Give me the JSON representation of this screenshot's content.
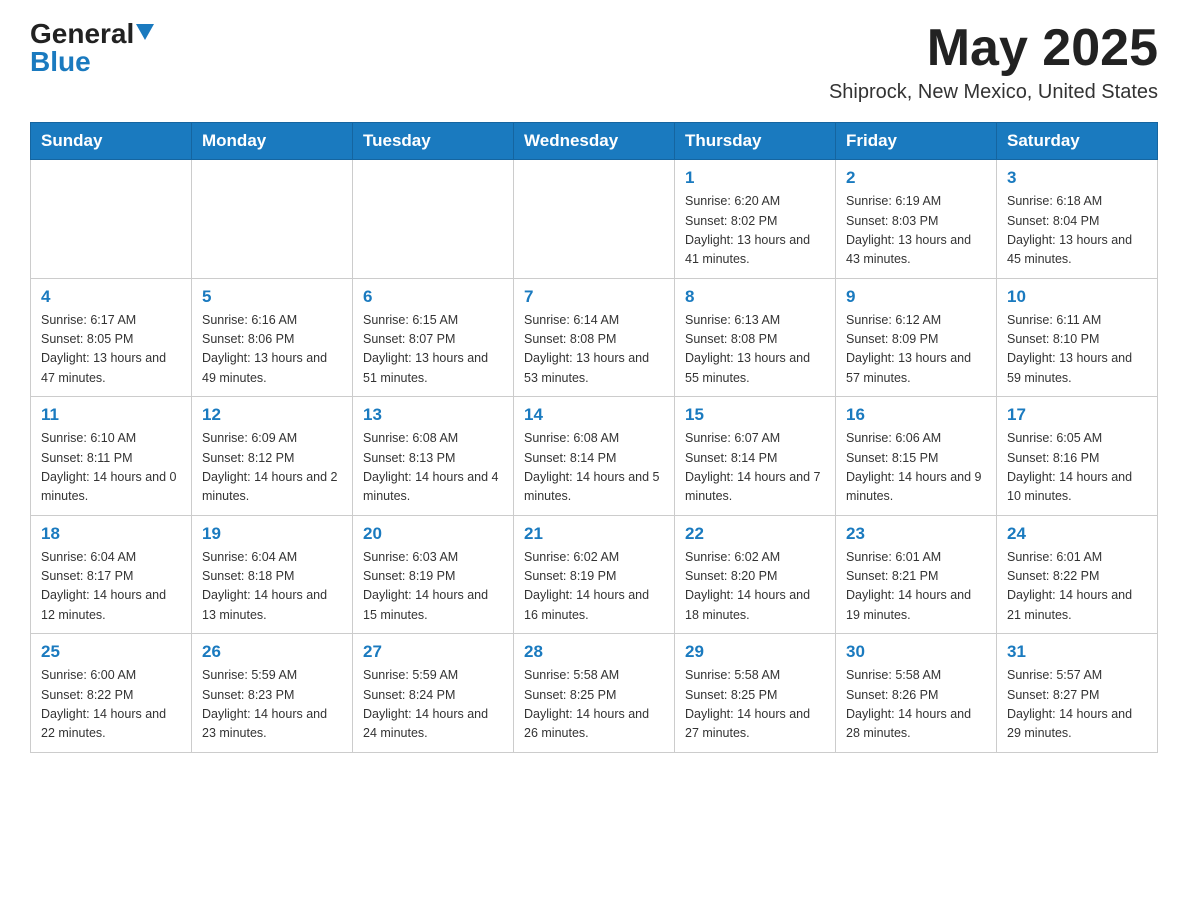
{
  "header": {
    "logo": {
      "general": "General",
      "blue": "Blue"
    },
    "title": "May 2025",
    "location": "Shiprock, New Mexico, United States"
  },
  "weekdays": [
    "Sunday",
    "Monday",
    "Tuesday",
    "Wednesday",
    "Thursday",
    "Friday",
    "Saturday"
  ],
  "weeks": [
    [
      {
        "day": "",
        "info": ""
      },
      {
        "day": "",
        "info": ""
      },
      {
        "day": "",
        "info": ""
      },
      {
        "day": "",
        "info": ""
      },
      {
        "day": "1",
        "info": "Sunrise: 6:20 AM\nSunset: 8:02 PM\nDaylight: 13 hours and 41 minutes."
      },
      {
        "day": "2",
        "info": "Sunrise: 6:19 AM\nSunset: 8:03 PM\nDaylight: 13 hours and 43 minutes."
      },
      {
        "day": "3",
        "info": "Sunrise: 6:18 AM\nSunset: 8:04 PM\nDaylight: 13 hours and 45 minutes."
      }
    ],
    [
      {
        "day": "4",
        "info": "Sunrise: 6:17 AM\nSunset: 8:05 PM\nDaylight: 13 hours and 47 minutes."
      },
      {
        "day": "5",
        "info": "Sunrise: 6:16 AM\nSunset: 8:06 PM\nDaylight: 13 hours and 49 minutes."
      },
      {
        "day": "6",
        "info": "Sunrise: 6:15 AM\nSunset: 8:07 PM\nDaylight: 13 hours and 51 minutes."
      },
      {
        "day": "7",
        "info": "Sunrise: 6:14 AM\nSunset: 8:08 PM\nDaylight: 13 hours and 53 minutes."
      },
      {
        "day": "8",
        "info": "Sunrise: 6:13 AM\nSunset: 8:08 PM\nDaylight: 13 hours and 55 minutes."
      },
      {
        "day": "9",
        "info": "Sunrise: 6:12 AM\nSunset: 8:09 PM\nDaylight: 13 hours and 57 minutes."
      },
      {
        "day": "10",
        "info": "Sunrise: 6:11 AM\nSunset: 8:10 PM\nDaylight: 13 hours and 59 minutes."
      }
    ],
    [
      {
        "day": "11",
        "info": "Sunrise: 6:10 AM\nSunset: 8:11 PM\nDaylight: 14 hours and 0 minutes."
      },
      {
        "day": "12",
        "info": "Sunrise: 6:09 AM\nSunset: 8:12 PM\nDaylight: 14 hours and 2 minutes."
      },
      {
        "day": "13",
        "info": "Sunrise: 6:08 AM\nSunset: 8:13 PM\nDaylight: 14 hours and 4 minutes."
      },
      {
        "day": "14",
        "info": "Sunrise: 6:08 AM\nSunset: 8:14 PM\nDaylight: 14 hours and 5 minutes."
      },
      {
        "day": "15",
        "info": "Sunrise: 6:07 AM\nSunset: 8:14 PM\nDaylight: 14 hours and 7 minutes."
      },
      {
        "day": "16",
        "info": "Sunrise: 6:06 AM\nSunset: 8:15 PM\nDaylight: 14 hours and 9 minutes."
      },
      {
        "day": "17",
        "info": "Sunrise: 6:05 AM\nSunset: 8:16 PM\nDaylight: 14 hours and 10 minutes."
      }
    ],
    [
      {
        "day": "18",
        "info": "Sunrise: 6:04 AM\nSunset: 8:17 PM\nDaylight: 14 hours and 12 minutes."
      },
      {
        "day": "19",
        "info": "Sunrise: 6:04 AM\nSunset: 8:18 PM\nDaylight: 14 hours and 13 minutes."
      },
      {
        "day": "20",
        "info": "Sunrise: 6:03 AM\nSunset: 8:19 PM\nDaylight: 14 hours and 15 minutes."
      },
      {
        "day": "21",
        "info": "Sunrise: 6:02 AM\nSunset: 8:19 PM\nDaylight: 14 hours and 16 minutes."
      },
      {
        "day": "22",
        "info": "Sunrise: 6:02 AM\nSunset: 8:20 PM\nDaylight: 14 hours and 18 minutes."
      },
      {
        "day": "23",
        "info": "Sunrise: 6:01 AM\nSunset: 8:21 PM\nDaylight: 14 hours and 19 minutes."
      },
      {
        "day": "24",
        "info": "Sunrise: 6:01 AM\nSunset: 8:22 PM\nDaylight: 14 hours and 21 minutes."
      }
    ],
    [
      {
        "day": "25",
        "info": "Sunrise: 6:00 AM\nSunset: 8:22 PM\nDaylight: 14 hours and 22 minutes."
      },
      {
        "day": "26",
        "info": "Sunrise: 5:59 AM\nSunset: 8:23 PM\nDaylight: 14 hours and 23 minutes."
      },
      {
        "day": "27",
        "info": "Sunrise: 5:59 AM\nSunset: 8:24 PM\nDaylight: 14 hours and 24 minutes."
      },
      {
        "day": "28",
        "info": "Sunrise: 5:58 AM\nSunset: 8:25 PM\nDaylight: 14 hours and 26 minutes."
      },
      {
        "day": "29",
        "info": "Sunrise: 5:58 AM\nSunset: 8:25 PM\nDaylight: 14 hours and 27 minutes."
      },
      {
        "day": "30",
        "info": "Sunrise: 5:58 AM\nSunset: 8:26 PM\nDaylight: 14 hours and 28 minutes."
      },
      {
        "day": "31",
        "info": "Sunrise: 5:57 AM\nSunset: 8:27 PM\nDaylight: 14 hours and 29 minutes."
      }
    ]
  ]
}
